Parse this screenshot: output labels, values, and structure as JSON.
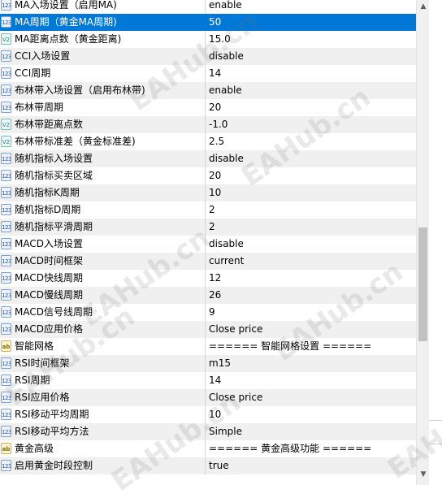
{
  "rows": [
    {
      "icon": "int",
      "name": "MA入场设置（启用MA)",
      "value": "enable"
    },
    {
      "icon": "int",
      "name": "MA周期（黄金MA周期)",
      "value": "50",
      "selected": true
    },
    {
      "icon": "dbl",
      "name": "MA距离点数（黄金距离)",
      "value": "15.0"
    },
    {
      "icon": "int",
      "name": "CCI入场设置",
      "value": "disable"
    },
    {
      "icon": "int",
      "name": "CCI周期",
      "value": "14"
    },
    {
      "icon": "int",
      "name": "布林带入场设置（启用布林带)",
      "value": "enable"
    },
    {
      "icon": "int",
      "name": "布林带周期",
      "value": "20"
    },
    {
      "icon": "dbl",
      "name": "布林带距离点数",
      "value": "-1.0"
    },
    {
      "icon": "dbl",
      "name": "布林带标准差（黄金标准差)",
      "value": "2.5"
    },
    {
      "icon": "int",
      "name": "随机指标入场设置",
      "value": "disable"
    },
    {
      "icon": "int",
      "name": "随机指标买卖区域",
      "value": "20"
    },
    {
      "icon": "int",
      "name": "随机指标K周期",
      "value": "10"
    },
    {
      "icon": "int",
      "name": "随机指标D周期",
      "value": "2"
    },
    {
      "icon": "int",
      "name": "随机指标平滑周期",
      "value": "2"
    },
    {
      "icon": "int",
      "name": "MACD入场设置",
      "value": "disable"
    },
    {
      "icon": "int",
      "name": "MACD时间框架",
      "value": "current"
    },
    {
      "icon": "int",
      "name": "MACD快线周期",
      "value": "12"
    },
    {
      "icon": "int",
      "name": "MACD慢线周期",
      "value": "26"
    },
    {
      "icon": "int",
      "name": "MACD信号线周期",
      "value": "9"
    },
    {
      "icon": "int",
      "name": "MACD应用价格",
      "value": "Close price"
    },
    {
      "icon": "str",
      "name": "智能网格",
      "value": "====== 智能网格设置 ======"
    },
    {
      "icon": "int",
      "name": "RSI时间框架",
      "value": "m15"
    },
    {
      "icon": "int",
      "name": "RSI周期",
      "value": "14"
    },
    {
      "icon": "int",
      "name": "RSI应用价格",
      "value": "Close price"
    },
    {
      "icon": "int",
      "name": "RSI移动平均周期",
      "value": "10"
    },
    {
      "icon": "int",
      "name": "RSI移动平均方法",
      "value": "Simple"
    },
    {
      "icon": "str",
      "name": "黄金高级",
      "value": "====== 黄金高级功能 ======"
    },
    {
      "icon": "int",
      "name": "启用黄金时段控制",
      "value": "true"
    }
  ],
  "icon_labels": {
    "int": "123",
    "dbl": "V2",
    "str": "ab"
  },
  "watermark": "EAHub.cn",
  "colors": {
    "selection": "#0078d7",
    "alt_row": "#f0f0f0"
  }
}
